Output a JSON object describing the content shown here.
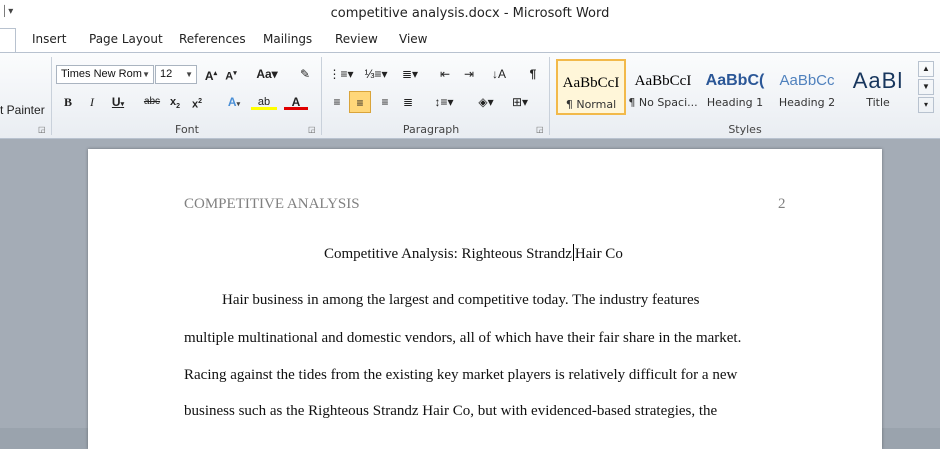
{
  "window": {
    "title": "competitive analysis.docx  -  Microsoft Word"
  },
  "tabs": [
    {
      "label": "e"
    },
    {
      "label": "Insert"
    },
    {
      "label": "Page Layout"
    },
    {
      "label": "References"
    },
    {
      "label": "Mailings"
    },
    {
      "label": "Review"
    },
    {
      "label": "View"
    }
  ],
  "clipboard": {
    "format_painter_label": "t Painter"
  },
  "font": {
    "name": "Times New Rom",
    "size": "12",
    "group_label": "Font"
  },
  "paragraph": {
    "group_label": "Paragraph"
  },
  "styles": {
    "group_label": "Styles",
    "items": [
      {
        "sample": "AaBbCcI",
        "name": "¶ Normal"
      },
      {
        "sample": "AaBbCcI",
        "name": "¶ No Spaci..."
      },
      {
        "sample": "AaBbC(",
        "name": "Heading 1"
      },
      {
        "sample": "AaBbCc",
        "name": "Heading 2"
      },
      {
        "sample": "AaBl",
        "name": "Title"
      }
    ]
  },
  "colors": {
    "heading": "#2b5797",
    "highlight": "#ffff00",
    "font_color": "#e00000"
  },
  "document": {
    "header_left": "COMPETITIVE ANALYSIS",
    "header_right": "2",
    "title_before_cursor": "Competitive Analysis:  Righteous Strandz",
    "title_after_cursor": "Hair Co",
    "lines": [
      "Hair business in among the largest and competitive today. The industry features",
      "multiple multinational  and domestic vendors, all of which have their fair share in the market.",
      "Racing against the tides from the existing key market players is relatively difficult for a new",
      "business such as the Righteous Strandz Hair Co, but with evidenced-based strategies, the"
    ]
  }
}
